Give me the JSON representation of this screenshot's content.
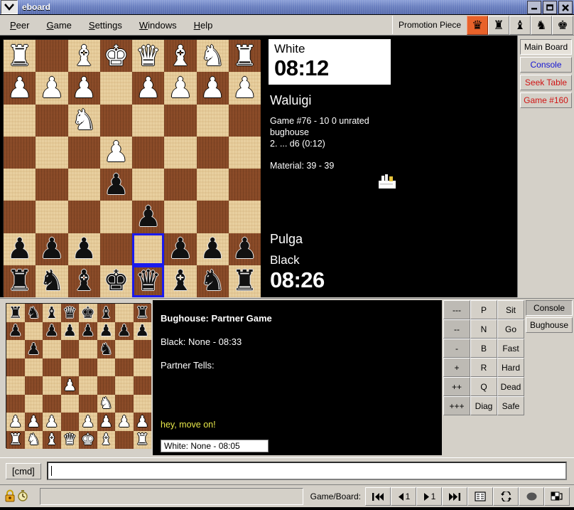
{
  "window": {
    "title": "eboard",
    "menu_icon": "window-menu-icon",
    "controls": {
      "minimize": "–",
      "maximize": "▢",
      "close": "✕"
    }
  },
  "menubar": {
    "items": [
      {
        "label": "Peer",
        "accel": "P"
      },
      {
        "label": "Game",
        "accel": "G"
      },
      {
        "label": "Settings",
        "accel": "S"
      },
      {
        "label": "Windows",
        "accel": "W"
      },
      {
        "label": "Help",
        "accel": "H"
      }
    ]
  },
  "toolbar": {
    "label": "Promotion Piece",
    "pieces": [
      {
        "name": "queen",
        "glyph": "♛",
        "selected": true
      },
      {
        "name": "rook",
        "glyph": "♜",
        "selected": false
      },
      {
        "name": "bishop",
        "glyph": "♝",
        "selected": false
      },
      {
        "name": "knight",
        "glyph": "♞",
        "selected": false
      },
      {
        "name": "king",
        "glyph": "♚",
        "selected": false
      }
    ]
  },
  "main_board": {
    "flipped": true,
    "highlight": [
      "r6c4",
      "r7c4"
    ],
    "rows": [
      [
        "wR",
        "",
        "wB",
        "wK",
        "wQ",
        "wB",
        "wN",
        "wR"
      ],
      [
        "wP",
        "wP",
        "wP",
        "",
        "wP",
        "wP",
        "wP",
        "wP"
      ],
      [
        "",
        "",
        "wN",
        "",
        "",
        "",
        "",
        ""
      ],
      [
        "",
        "",
        "",
        "wP",
        "",
        "",
        "",
        ""
      ],
      [
        "",
        "",
        "",
        "bP",
        "",
        "",
        "",
        ""
      ],
      [
        "",
        "",
        "",
        "",
        "bP",
        "",
        "",
        ""
      ],
      [
        "bP",
        "bP",
        "bP",
        "",
        "",
        "bP",
        "bP",
        "bP"
      ],
      [
        "bR",
        "bN",
        "bB",
        "bK",
        "bQ",
        "bB",
        "bN",
        "bR"
      ]
    ]
  },
  "game_info": {
    "top_clock_label": "White",
    "top_clock_time": "08:12",
    "top_player": "Waluigi",
    "description_line1": "Game #76 - 10 0 unrated",
    "description_line2": "bughouse",
    "description_line3": "2. ... d6 (0:12)",
    "material": "Material: 39 - 39",
    "holding_icon": "piece-holdings-icon",
    "bottom_player": "Pulga",
    "bottom_clock_label": "Black",
    "bottom_clock_time": "08:26"
  },
  "board_tabs": [
    {
      "label": "Main Board",
      "state": "selected",
      "color": "#000000"
    },
    {
      "label": "Console",
      "state": "normal",
      "color": "#1414d2"
    },
    {
      "label": "Seek Table",
      "state": "normal",
      "color": "#d01414"
    },
    {
      "label": "Game #160",
      "state": "normal",
      "color": "#d01414"
    }
  ],
  "partner_board": {
    "rows": [
      [
        "bR",
        "bN",
        "bB",
        "bQ",
        "bK",
        "bB",
        "",
        "bR"
      ],
      [
        "bP",
        "",
        "bP",
        "bP",
        "bP",
        "bP",
        "bP",
        "bP"
      ],
      [
        "",
        "bP",
        "",
        "",
        "",
        "bN",
        "",
        ""
      ],
      [
        "",
        "",
        "",
        "",
        "",
        "",
        "",
        ""
      ],
      [
        "",
        "",
        "",
        "wP",
        "",
        "",
        "",
        ""
      ],
      [
        "",
        "",
        "",
        "",
        "",
        "wN",
        "",
        ""
      ],
      [
        "wP",
        "wP",
        "wP",
        "",
        "wP",
        "wP",
        "wP",
        "wP"
      ],
      [
        "wR",
        "wN",
        "wB",
        "wQ",
        "wK",
        "wB",
        "",
        "wR"
      ]
    ]
  },
  "partner_panel": {
    "title": "Bughouse: Partner Game",
    "black_line": "Black: None - 08:33",
    "tells_label": "Partner Tells:",
    "tell_message": "hey, move on!",
    "white_line": "White: None - 08:05",
    "tell_color": "#e8e84a"
  },
  "quick_buttons": {
    "rows": [
      [
        "---",
        "P",
        "Sit"
      ],
      [
        "--",
        "N",
        "Go"
      ],
      [
        "-",
        "B",
        "Fast"
      ],
      [
        "+",
        "R",
        "Hard"
      ],
      [
        "++",
        "Q",
        "Dead"
      ],
      [
        "+++",
        "Diag",
        "Safe"
      ]
    ]
  },
  "console_tabs": [
    {
      "label": "Console",
      "state": "selected"
    },
    {
      "label": "Bughouse",
      "state": "normal"
    }
  ],
  "command_bar": {
    "button_label": "[cmd]",
    "input_value": "",
    "input_placeholder": ""
  },
  "statusbar": {
    "lock_icon": "lock-icon",
    "clock_icon": "clock-icon",
    "message": "",
    "game_board_label": "Game/Board:",
    "nav_buttons": [
      {
        "name": "first-move-button",
        "glyph": "|◀◀",
        "badge": ""
      },
      {
        "name": "prev-move-button",
        "glyph": "◀",
        "badge": "1"
      },
      {
        "name": "next-move-button",
        "glyph": "▶",
        "badge": "1"
      },
      {
        "name": "last-move-button",
        "glyph": "▶▶|",
        "badge": ""
      },
      {
        "name": "move-list-button",
        "glyph": "▤",
        "badge": ""
      },
      {
        "name": "refresh-button",
        "glyph": "⟳",
        "badge": ""
      },
      {
        "name": "board-style-button",
        "glyph": "◍",
        "badge": ""
      },
      {
        "name": "flip-board-button",
        "glyph": "◨",
        "badge": ""
      }
    ]
  }
}
